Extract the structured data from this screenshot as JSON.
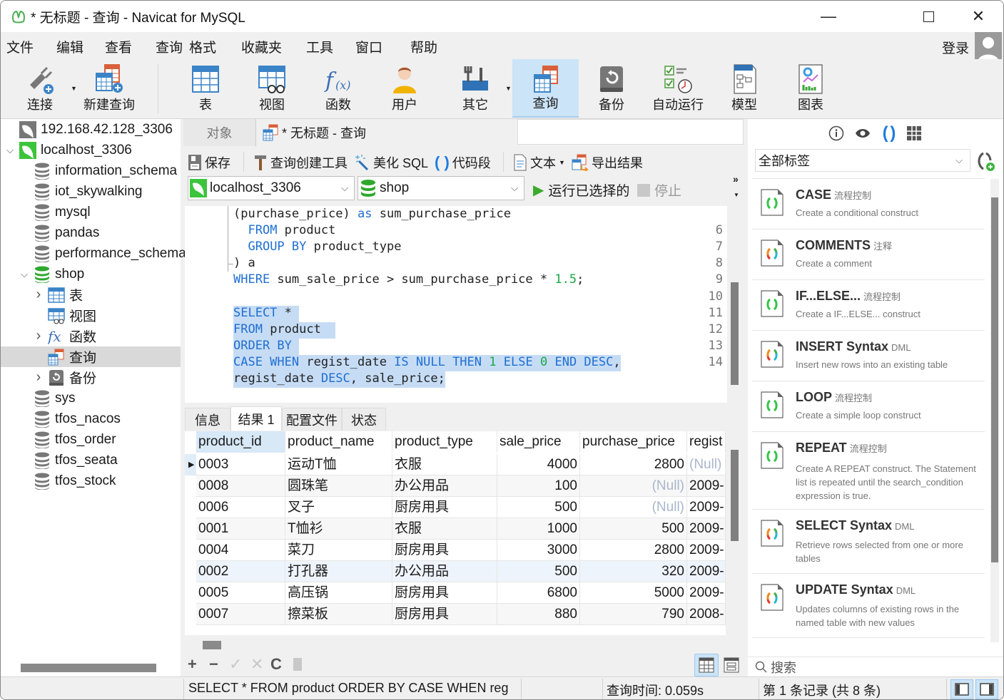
{
  "window": {
    "title": "* 无标题 - 查询 - Navicat for MySQL",
    "minimize_label": "—",
    "maximize_label": "☐",
    "close_label": "✕"
  },
  "menu": {
    "items": [
      "文件",
      "编辑",
      "查看",
      "查询",
      "格式",
      "收藏夹",
      "工具",
      "窗口",
      "帮助"
    ],
    "login_label": "登录"
  },
  "toolbar": {
    "items": [
      {
        "label": "连接",
        "icon": "connection-plug-icon"
      },
      {
        "label": "新建查询",
        "icon": "new-query-icon"
      },
      {
        "label": "表",
        "icon": "table-icon"
      },
      {
        "label": "视图",
        "icon": "view-icon"
      },
      {
        "label": "函数",
        "icon": "function-icon"
      },
      {
        "label": "用户",
        "icon": "user-icon"
      },
      {
        "label": "其它",
        "icon": "tools-icon"
      },
      {
        "label": "查询",
        "icon": "query-icon",
        "active": true
      },
      {
        "label": "备份",
        "icon": "backup-icon"
      },
      {
        "label": "自动运行",
        "icon": "automation-icon"
      },
      {
        "label": "模型",
        "icon": "model-icon"
      },
      {
        "label": "图表",
        "icon": "chart-icon"
      }
    ]
  },
  "sidebar": {
    "tree": [
      {
        "label": "192.168.42.128_3306",
        "type": "connection-inactive",
        "level": 0
      },
      {
        "label": "localhost_3306",
        "type": "connection-active",
        "level": 0,
        "expanded": true
      },
      {
        "label": "information_schema",
        "type": "database",
        "level": 1
      },
      {
        "label": "iot_skywalking",
        "type": "database",
        "level": 1
      },
      {
        "label": "mysql",
        "type": "database",
        "level": 1
      },
      {
        "label": "pandas",
        "type": "database",
        "level": 1
      },
      {
        "label": "performance_schema",
        "type": "database",
        "level": 1
      },
      {
        "label": "shop",
        "type": "database-open",
        "level": 1,
        "expanded": true
      },
      {
        "label": "表",
        "type": "tables",
        "level": 2,
        "collapsed": true
      },
      {
        "label": "视图",
        "type": "views",
        "level": 2
      },
      {
        "label": "函数",
        "type": "functions",
        "level": 2,
        "collapsed": true
      },
      {
        "label": "查询",
        "type": "queries",
        "level": 2,
        "selected": true
      },
      {
        "label": "备份",
        "type": "backups",
        "level": 2,
        "collapsed": true
      },
      {
        "label": "sys",
        "type": "database",
        "level": 1
      },
      {
        "label": "tfos_nacos",
        "type": "database",
        "level": 1
      },
      {
        "label": "tfos_order",
        "type": "database",
        "level": 1
      },
      {
        "label": "tfos_seata",
        "type": "database",
        "level": 1
      },
      {
        "label": "tfos_stock",
        "type": "database",
        "level": 1
      }
    ]
  },
  "tabs": {
    "objects_label": "对象",
    "query_tab_label": "* 无标题 - 查询"
  },
  "query_toolbar": {
    "save": "保存",
    "query_builder": "查询创建工具",
    "beautify": "美化 SQL",
    "snippets": "代码段",
    "text": "文本",
    "export": "导出结果",
    "connection": "localhost_3306",
    "database": "shop",
    "run_selected": "运行已选择的",
    "stop": "停止",
    "overflow": "»"
  },
  "editor": {
    "lines": [
      {
        "num": "",
        "html": "(purchase_price) <span class=\"kw\">as</span> sum_purchase_price",
        "selected": false
      },
      {
        "num": "6",
        "html": "  <span class=\"kw\">FROM</span> product",
        "selected": false
      },
      {
        "num": "7",
        "html": "  <span class=\"kw\">GROUP BY</span> product_type",
        "selected": false
      },
      {
        "num": "8",
        "html": ") a",
        "selected": false
      },
      {
        "num": "9",
        "html": "<span class=\"kw\">WHERE</span> sum_sale_price &gt; sum_purchase_price * <span class=\"num\">1.5</span>;",
        "selected": false,
        "indent0": true
      },
      {
        "num": "10",
        "html": "",
        "selected": false
      },
      {
        "num": "11",
        "html": "<span class=\"kw\">SELECT</span> * ",
        "selected": true
      },
      {
        "num": "12",
        "html": "<span class=\"kw\">FROM</span> product  ",
        "selected": true
      },
      {
        "num": "13",
        "html": "<span class=\"kw\">ORDER BY</span> ",
        "selected": true
      },
      {
        "num": "14",
        "html": "<span class=\"kw\">CASE WHEN</span> regist_date <span class=\"kw\">IS NULL THEN</span> <span class=\"num\">1</span> <span class=\"kw\">ELSE</span> <span class=\"num\">0</span> <span class=\"kw\">END DESC</span>,",
        "selected": true
      },
      {
        "num": "",
        "html": "regist_date <span class=\"kw\">DESC</span>, sale_price;",
        "selected": true
      }
    ]
  },
  "result_tabs": [
    "信息",
    "结果 1",
    "配置文件",
    "状态"
  ],
  "result_grid": {
    "columns": [
      "product_id",
      "product_name",
      "product_type",
      "sale_price",
      "purchase_price",
      "regist"
    ],
    "rows": [
      [
        "0003",
        "运动T恤",
        "衣服",
        "4000",
        "2800",
        "(Null)"
      ],
      [
        "0008",
        "圆珠笔",
        "办公用品",
        "100",
        "(Null)",
        "2009-"
      ],
      [
        "0006",
        "叉子",
        "厨房用具",
        "500",
        "(Null)",
        "2009-"
      ],
      [
        "0001",
        "T恤衫",
        "衣服",
        "1000",
        "500",
        "2009-"
      ],
      [
        "0004",
        "菜刀",
        "厨房用具",
        "3000",
        "2800",
        "2009-"
      ],
      [
        "0002",
        "打孔器",
        "办公用品",
        "500",
        "320",
        "2009-"
      ],
      [
        "0005",
        "高压锅",
        "厨房用具",
        "6800",
        "5000",
        "2009-"
      ],
      [
        "0007",
        "擦菜板",
        "厨房用具",
        "880",
        "790",
        "2008-"
      ]
    ]
  },
  "grid_tools": {
    "add": "+",
    "remove": "−",
    "apply": "✓",
    "discard": "✕",
    "refresh": "C"
  },
  "snippet_panel": {
    "tag_filter": "全部标签",
    "search_placeholder": "搜索",
    "items": [
      {
        "name": "CASE",
        "tag": "流程控制",
        "desc": "Create a conditional construct",
        "color": "green"
      },
      {
        "name": "COMMENTS",
        "tag": "注释",
        "desc": "Create a comment",
        "color": "multi"
      },
      {
        "name": "IF...ELSE...",
        "tag": "流程控制",
        "desc": "Create a IF...ELSE... construct",
        "color": "green"
      },
      {
        "name": "INSERT Syntax",
        "tag": "DML",
        "desc": "Insert new rows into an existing table",
        "color": "multi"
      },
      {
        "name": "LOOP",
        "tag": "流程控制",
        "desc": "Create a simple loop construct",
        "color": "green"
      },
      {
        "name": "REPEAT",
        "tag": "流程控制",
        "desc": "Create A REPEAT construct. The Statement list is repeated until the search_condition expression is true.",
        "color": "green"
      },
      {
        "name": "SELECT Syntax",
        "tag": "DML",
        "desc": "Retrieve rows selected from one or more tables",
        "color": "multi"
      },
      {
        "name": "UPDATE Syntax",
        "tag": "DML",
        "desc": "Updates columns of existing rows in the named table with new values",
        "color": "multi"
      }
    ]
  },
  "status": {
    "sql": "SELECT *  FROM product  ORDER BY  CASE WHEN reg",
    "query_time": "查询时间: 0.059s",
    "record": "第 1 条记录 (共 8 条)"
  },
  "colors": {
    "accent": "#1f6fd1",
    "selection": "#c6dcf5",
    "active_button": "#cce4f7",
    "null_text": "#a9b6cc",
    "snippet_green": "#33c448"
  }
}
